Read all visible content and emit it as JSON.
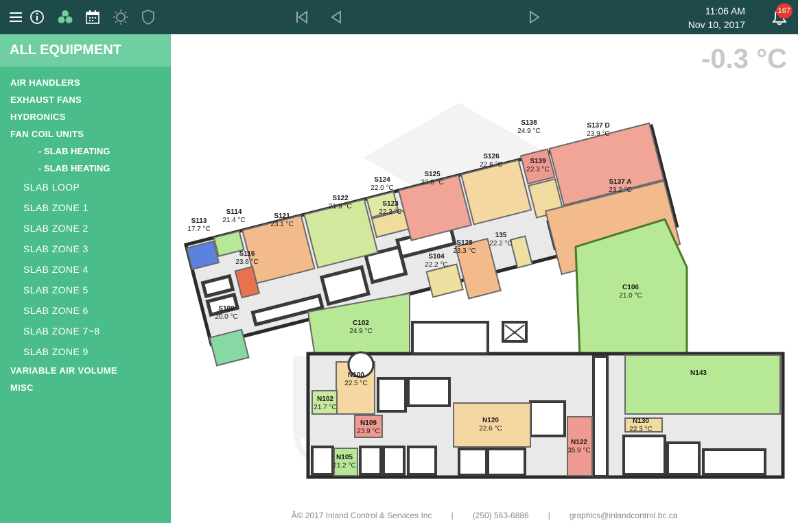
{
  "header": {
    "time": "11:06 AM",
    "date": "Nov 10, 2017",
    "notification_count": "167",
    "icons": [
      "menu-icon",
      "info-icon",
      "fan-icon",
      "calendar-icon",
      "sun-icon",
      "shield-icon",
      "skip-back-icon",
      "previous-icon",
      "next-icon",
      "bell-icon"
    ]
  },
  "sidebar": {
    "title": "ALL EQUIPMENT",
    "categories": {
      "air_handlers": "AIR HANDLERS",
      "exhaust_fans": "EXHAUST FANS",
      "hydronics": "HYDRONICS",
      "fan_coil_units": "FAN COIL UNITS",
      "slab_heating_1": "- SLAB HEATING",
      "slab_heating_2": "- SLAB HEATING",
      "variable_air_volume": "VARIABLE AIR VOLUME",
      "misc": "MISC"
    },
    "zones": [
      "SLAB LOOP",
      "SLAB ZONE 1",
      "SLAB ZONE 2",
      "SLAB ZONE 3",
      "SLAB ZONE 4",
      "SLAB ZONE 5",
      "SLAB ZONE 6",
      "SLAB ZONE 7~8",
      "SLAB ZONE 9"
    ]
  },
  "main": {
    "outside_temp": "-0.3 °C",
    "rooms": [
      {
        "name": "S113",
        "temp": "17.7 °C",
        "color": "#5b82e0"
      },
      {
        "name": "S114",
        "temp": "21.4 °C",
        "color": "#b7e896"
      },
      {
        "name": "S121",
        "temp": "23.1 °C",
        "color": "#f3bb8c"
      },
      {
        "name": "S122",
        "temp": "21.9 °C",
        "color": "#d2e89d"
      },
      {
        "name": "S124",
        "temp": "22.0 °C",
        "color": "#e0e8a6"
      },
      {
        "name": "S123",
        "temp": "22.3 °C",
        "color": "#f0dc9e"
      },
      {
        "name": "S125",
        "temp": "23.8 °C",
        "color": "#f1a597"
      },
      {
        "name": "S126",
        "temp": "22.6 °C",
        "color": "#f5d7a2"
      },
      {
        "name": "S138",
        "temp": "24.9 °C",
        "color": "#ef9990"
      },
      {
        "name": "S137 D",
        "temp": "23.9 °C",
        "color": "#f1a597"
      },
      {
        "name": "S139",
        "temp": "22.3 °C",
        "color": "#f0dc9e"
      },
      {
        "name": "S137 A",
        "temp": "23.2 °C",
        "color": "#f3bb8c"
      },
      {
        "name": "S116",
        "temp": "23.6 °C",
        "color": "#e8714e"
      },
      {
        "name": "S128",
        "temp": "23.3 °C",
        "color": "#f3bb8c"
      },
      {
        "name": "S104",
        "temp": "22.2 °C",
        "color": "#eee0a0"
      },
      {
        "name": "135",
        "temp": "22.2 °C",
        "color": "#eee0a0"
      },
      {
        "name": "S109",
        "temp": "20.0 °C",
        "color": "#88d8a4"
      },
      {
        "name": "C102",
        "temp": "24.9 °C",
        "color": "#b7e896"
      },
      {
        "name": "C106",
        "temp": "21.0 °C",
        "color": "#b7e896"
      },
      {
        "name": "N100",
        "temp": "22.5 °C",
        "color": "#f5d7a2"
      },
      {
        "name": "N102",
        "temp": "21.7 °C",
        "color": "#c8eaa0"
      },
      {
        "name": "N109",
        "temp": "23.9 °C",
        "color": "#ef9990"
      },
      {
        "name": "N120",
        "temp": "22.6 °C",
        "color": "#f5d7a2"
      },
      {
        "name": "N122",
        "temp": "35.9 °C",
        "color": "#ef9990"
      },
      {
        "name": "N143",
        "temp": "",
        "color": "#b7e896"
      },
      {
        "name": "N130",
        "temp": "22.3 °C",
        "color": "#f0dc9e"
      },
      {
        "name": "N105",
        "temp": "21.2 °C",
        "color": "#b7e896"
      }
    ]
  },
  "footer": {
    "copyright": "Â© 2017 Inland Control & Services Inc",
    "separator": "|",
    "phone": "(250) 563-6886",
    "email": "graphics@inlandcontrol.bc.ca"
  }
}
